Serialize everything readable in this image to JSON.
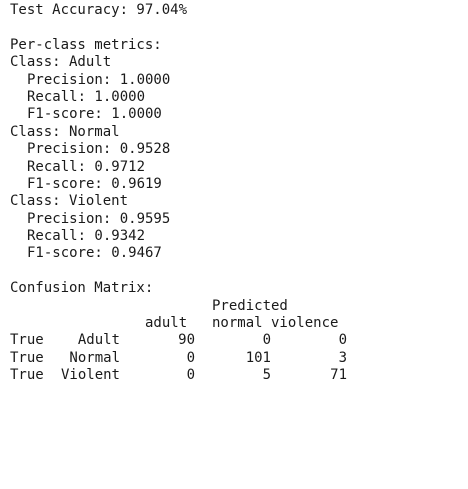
{
  "accuracy_line": "Test Accuracy: 97.04%",
  "per_class_header": "Per-class metrics:",
  "classes": [
    {
      "label": "Class: Adult",
      "precision": "Precision: 1.0000",
      "recall": "Recall: 1.0000",
      "f1": "F1-score: 1.0000"
    },
    {
      "label": "Class: Normal",
      "precision": "Precision: 0.9528",
      "recall": "Recall: 0.9712",
      "f1": "F1-score: 0.9619"
    },
    {
      "label": "Class: Violent",
      "precision": "Precision: 0.9595",
      "recall": "Recall: 0.9342",
      "f1": "F1-score: 0.9467"
    }
  ],
  "confusion": {
    "header": "Confusion Matrix:",
    "predicted_label": "Predicted",
    "columns": [
      "adult",
      "normal",
      "violence"
    ],
    "row_prefix": "True",
    "rows": [
      {
        "label": "Adult",
        "values": [
          "90",
          "0",
          "0"
        ]
      },
      {
        "label": "Normal",
        "values": [
          "0",
          "101",
          "3"
        ]
      },
      {
        "label": "Violent",
        "values": [
          "0",
          "5",
          "71"
        ]
      }
    ]
  }
}
